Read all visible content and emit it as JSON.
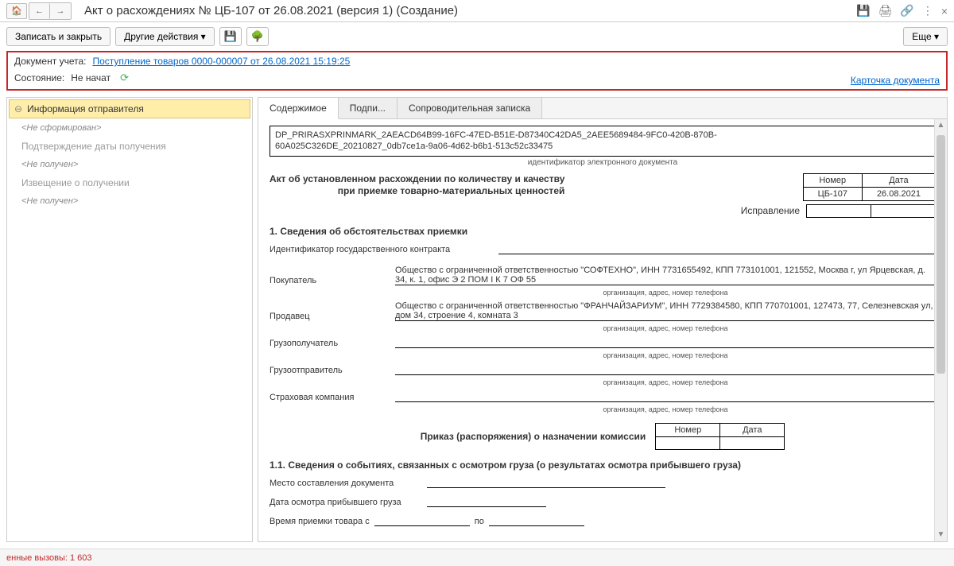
{
  "title": "Акт о расхождениях № ЦБ-107 от 26.08.2021 (версия 1) (Создание)",
  "toolbar": {
    "save_close": "Записать и закрыть",
    "other_actions": "Другие действия ▾",
    "more": "Еще ▾"
  },
  "info": {
    "doc_label": "Документ учета:",
    "doc_link": "Поступление товаров 0000-000007 от 26.08.2021 15:19:25",
    "state_label": "Состояние:",
    "state_value": "Не начат",
    "card_link": "Карточка документа"
  },
  "left": {
    "header": "Информация отправителя",
    "not_formed": "<Не сформирован>",
    "confirm": "Подтверждение даты получения",
    "not_received1": "<Не получен>",
    "notice": "Извещение о получении",
    "not_received2": "<Не получен>"
  },
  "tabs": {
    "content": "Содержимое",
    "sign": "Подпи...",
    "cover": "Сопроводительная записка"
  },
  "doc": {
    "id_line1": "DP_PRIRASXPRINMARK_2AEACD64B99-16FC-47ED-B51E-D87340C42DA5_2AEE5689484-9FC0-420B-870B-",
    "id_line2": "60A025C326DE_20210827_0db7ce1a-9a06-4d62-b6b1-513c52c33475",
    "id_label": "идентификатор электронного документа",
    "head1": "Акт об установленном расхождении по количеству и качеству",
    "head2": "при приемке товарно-материальных ценностей",
    "num_h": "Номер",
    "date_h": "Дата",
    "num_v": "ЦБ-107",
    "date_v": "26.08.2021",
    "corr": "Исправление",
    "s1": "1. Сведения об обстоятельствах приемки",
    "contract_id": "Идентификатор государственного контракта",
    "buyer_label": "Покупатель",
    "buyer_val": "Общество с ограниченной ответственностью \"СОФТЕХНО\", ИНН 7731655492, КПП 773101001, 121552, Москва г, ул Ярцевская, д. 34, к. 1, офис Э 2 ПОМ I К 7 ОФ 55",
    "org_hint": "организация, адрес, номер телефона",
    "seller_label": "Продавец",
    "seller_val": "Общество с ограниченной ответственностью \"ФРАНЧАЙЗАРИУМ\", ИНН 7729384580, КПП 770701001, 127473, 77, Селезневская ул, дом 34, строение 4, комната 3",
    "consignee": "Грузополучатель",
    "consignor": "Грузоотправитель",
    "insurance": "Страховая компания",
    "order": "Приказ (распоряжения) о назначении комиссии",
    "s11": "1.1. Сведения о событиях, связанных с осмотром груза (о результатах осмотра прибывшего груза)",
    "place": "Место составления документа",
    "insp_date": "Дата осмотра прибывшего груза",
    "recv_time": "Время приемки товара с",
    "to": "по"
  },
  "footer": {
    "calls_label": "енные вызовы: ",
    "calls_value": "1 603"
  }
}
